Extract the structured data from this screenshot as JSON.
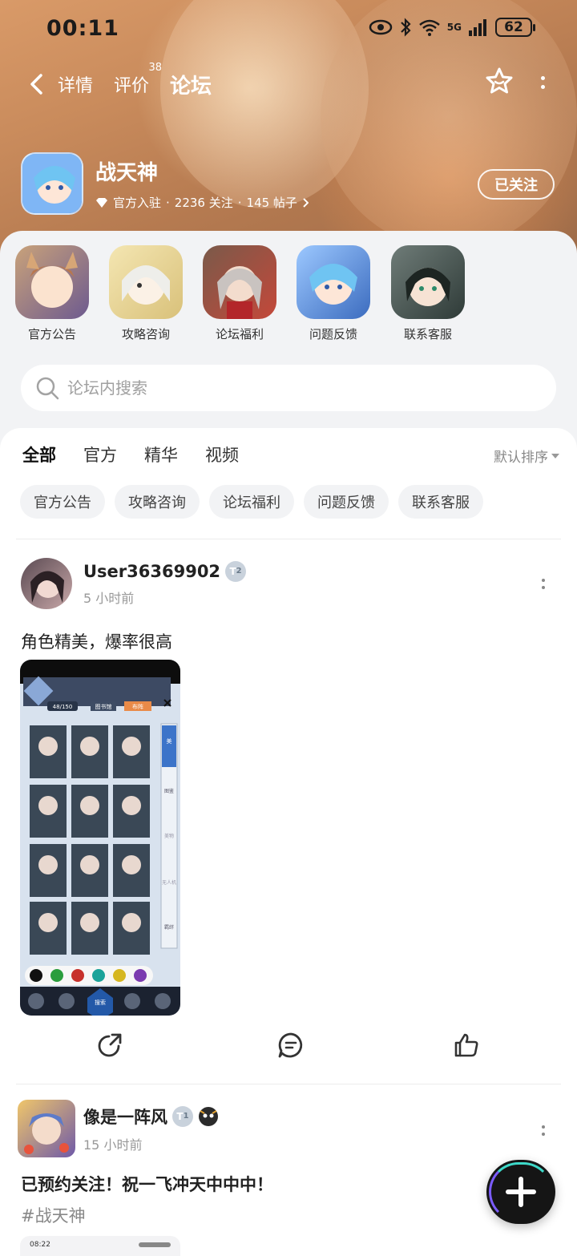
{
  "status_bar": {
    "time": "00:11",
    "network": "5G",
    "battery": "62"
  },
  "nav": {
    "tabs": [
      {
        "label": "详情"
      },
      {
        "label": "评价",
        "badge": "38"
      },
      {
        "label": "论坛"
      }
    ]
  },
  "game": {
    "name": "战天神",
    "official": "官方入驻",
    "followers": "2236 关注",
    "posts": "145 帖子",
    "follow_label": "已关注"
  },
  "shortcuts": [
    {
      "label": "官方公告"
    },
    {
      "label": "攻略咨询"
    },
    {
      "label": "论坛福利"
    },
    {
      "label": "问题反馈"
    },
    {
      "label": "联系客服"
    }
  ],
  "search": {
    "placeholder": "论坛内搜索"
  },
  "filter_tabs": [
    {
      "label": "全部"
    },
    {
      "label": "官方"
    },
    {
      "label": "精华"
    },
    {
      "label": "视频"
    }
  ],
  "sort_label": "默认排序",
  "chips": [
    {
      "label": "官方公告"
    },
    {
      "label": "攻略咨询"
    },
    {
      "label": "论坛福利"
    },
    {
      "label": "问题反馈"
    },
    {
      "label": "联系客服"
    }
  ],
  "posts": [
    {
      "username": "User36369902",
      "level": "2",
      "time": "5 小时前",
      "text": "角色精美，爆率很高",
      "screenshot_texts": {
        "tab_library": "图书馆",
        "tab_formation": "布阵",
        "count": "48/150",
        "search_btn": "搜索",
        "side_tabs": [
          "美",
          "图鉴",
          "美物",
          "无人机",
          "羁绊"
        ]
      }
    },
    {
      "username": "像是一阵风",
      "level": "1",
      "time": "15 小时前",
      "text": "已预约关注！祝一飞冲天中中中！",
      "tag": "#战天神",
      "preview_time": "08:22"
    }
  ],
  "colors": {
    "accent": "#31d2c4",
    "fab": "#151515"
  }
}
